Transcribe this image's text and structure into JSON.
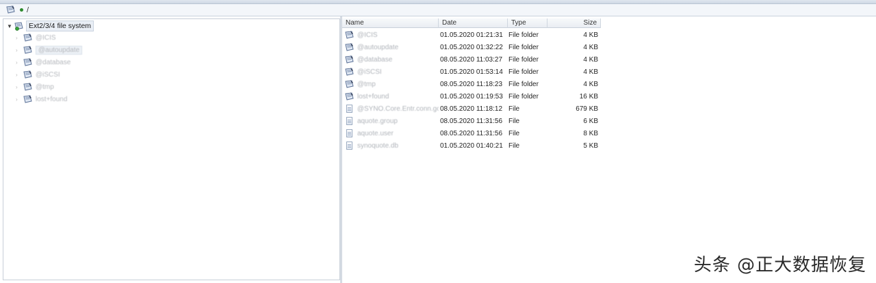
{
  "pathbar": {
    "path": "/"
  },
  "tree": {
    "root_label": "Ext2/3/4 file system",
    "children": [
      {
        "label": "@ICIS"
      },
      {
        "label": "@autoupdate"
      },
      {
        "label": "@database"
      },
      {
        "label": "@iSCSI"
      },
      {
        "label": "@tmp"
      },
      {
        "label": "lost+found"
      }
    ]
  },
  "list": {
    "columns": {
      "name": "Name",
      "date": "Date",
      "type": "Type",
      "size": "Size"
    },
    "rows": [
      {
        "name": "@ICIS",
        "date": "01.05.2020 01:21:31",
        "type": "File folder",
        "size": "4 KB",
        "icon": "drive"
      },
      {
        "name": "@autoupdate",
        "date": "01.05.2020 01:32:22",
        "type": "File folder",
        "size": "4 KB",
        "icon": "drive"
      },
      {
        "name": "@database",
        "date": "08.05.2020 11:03:27",
        "type": "File folder",
        "size": "4 KB",
        "icon": "drive"
      },
      {
        "name": "@iSCSI",
        "date": "01.05.2020 01:53:14",
        "type": "File folder",
        "size": "4 KB",
        "icon": "drive"
      },
      {
        "name": "@tmp",
        "date": "08.05.2020 11:18:23",
        "type": "File folder",
        "size": "4 KB",
        "icon": "drive"
      },
      {
        "name": "lost+found",
        "date": "01.05.2020 01:19:53",
        "type": "File folder",
        "size": "16 KB",
        "icon": "drive"
      },
      {
        "name": "@SYNO.Core.Entr.conn.go",
        "date": "08.05.2020 11:18:12",
        "type": "File",
        "size": "679 KB",
        "icon": "file"
      },
      {
        "name": "aquote.group",
        "date": "08.05.2020 11:31:56",
        "type": "File",
        "size": "6 KB",
        "icon": "file"
      },
      {
        "name": "aquote.user",
        "date": "08.05.2020 11:31:56",
        "type": "File",
        "size": "8 KB",
        "icon": "file"
      },
      {
        "name": "synoquote.db",
        "date": "01.05.2020 01:40:21",
        "type": "File",
        "size": "5 KB",
        "icon": "file"
      }
    ]
  },
  "watermark": "头条 @正大数据恢复"
}
